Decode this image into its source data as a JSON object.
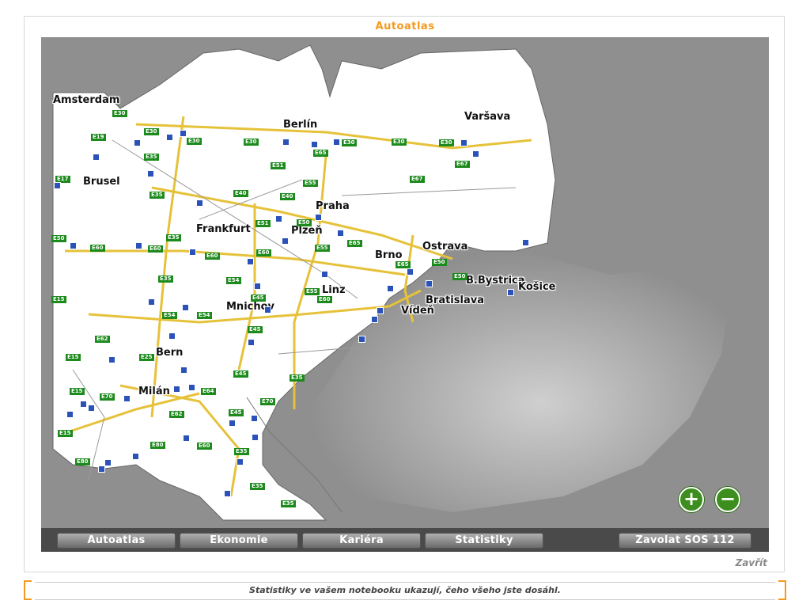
{
  "window": {
    "title": "Autoatlas",
    "close_label": "Zavřít"
  },
  "map": {
    "cities": [
      "Amsterdam",
      "Berlín",
      "Varšava",
      "Brusel",
      "Praha",
      "Frankfurt",
      "Plzeň",
      "Ostrava",
      "Brno",
      "B.Bystrica",
      "Košice",
      "Linz",
      "Bratislava",
      "Vídeň",
      "Mnichov",
      "Bern",
      "Milán"
    ],
    "roads": [
      "E30",
      "E30",
      "E19",
      "E30",
      "E30",
      "E30",
      "E30",
      "E30",
      "E35",
      "E51",
      "E65",
      "E67",
      "E17",
      "E35",
      "E40",
      "E40",
      "E55",
      "E67",
      "E51",
      "E50",
      "E65",
      "E35",
      "E50",
      "E60",
      "E60",
      "E60",
      "E60",
      "E50",
      "E55",
      "E65",
      "E50",
      "E35",
      "E54",
      "E45",
      "E55",
      "E60",
      "E15",
      "E54",
      "E54",
      "E45",
      "E62",
      "E25",
      "E15",
      "E45",
      "E35",
      "E15",
      "E70",
      "E64",
      "E45",
      "E70",
      "E62",
      "E15",
      "E80",
      "E80",
      "E60",
      "E35",
      "E35",
      "E35"
    ],
    "zoom_in_label": "+",
    "zoom_out_label": "−"
  },
  "nav": {
    "buttons": [
      "Autoatlas",
      "Ekonomie",
      "Kariéra",
      "Statistiky"
    ],
    "sos_label": "Zavolat SOS 112"
  },
  "status": {
    "message": "Statistiky ve vašem notebooku ukazují, čeho všeho jste dosáhl."
  },
  "colors": {
    "accent": "#f39a1e",
    "road_badge": "#1c8a1c",
    "pump": "#2a52b8"
  }
}
